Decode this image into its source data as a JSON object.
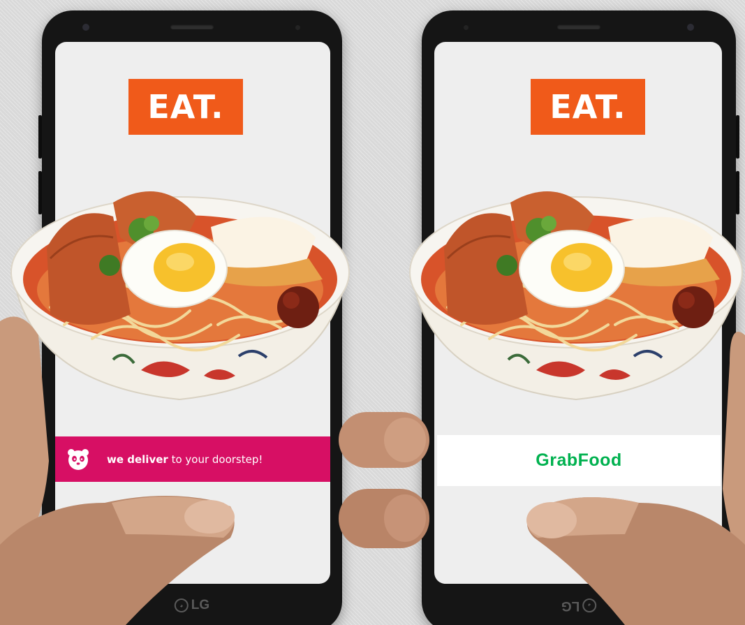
{
  "scene": {
    "background": "#d9d9d9",
    "left_phone": {
      "logo_text": "EAT.",
      "logo_color": "#f05a1a",
      "promo": {
        "icon": "panda-icon",
        "bold_text": "we deliver",
        "rest_text": " to your doorstep!",
        "color": "#d70f64"
      },
      "brand": "LG"
    },
    "right_phone": {
      "logo_text": "EAT.",
      "logo_color": "#f05a1a",
      "promo": {
        "logo_text": "GrabFood",
        "color": "#00b14f"
      },
      "brand": "LG"
    }
  }
}
